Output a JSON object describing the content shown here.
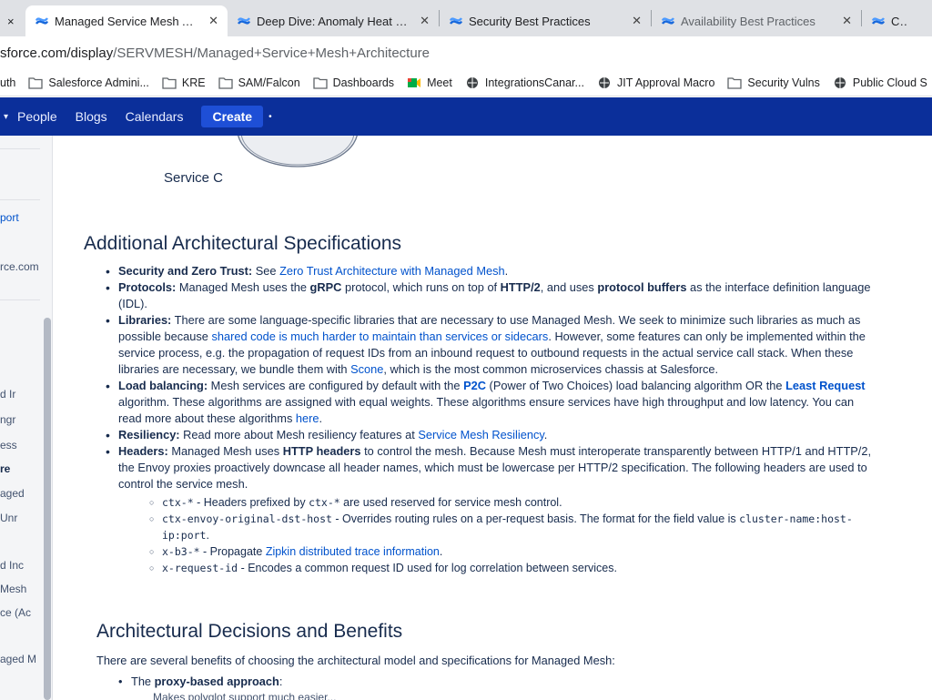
{
  "tabs": [
    {
      "title": "Managed Service Mesh Archite",
      "active": true
    },
    {
      "title": "Deep Dive: Anomaly Heat M..."
    },
    {
      "title": "Security Best Practices"
    },
    {
      "title": "Availability Best Practices"
    },
    {
      "title": "Chan"
    }
  ],
  "left_tab_close": "×",
  "url": {
    "host": "sforce.com/display",
    "path": "/SERVMESH/Managed+Service+Mesh+Architecture"
  },
  "bookmarks": [
    {
      "label": "uth",
      "icon": "none"
    },
    {
      "label": "Salesforce Admini...",
      "icon": "folder-icon"
    },
    {
      "label": "KRE",
      "icon": "folder-icon"
    },
    {
      "label": "SAM/Falcon",
      "icon": "folder-icon"
    },
    {
      "label": "Dashboards",
      "icon": "folder-icon"
    },
    {
      "label": "Meet",
      "icon": "meet-icon"
    },
    {
      "label": "IntegrationsCanar...",
      "icon": "globe-icon"
    },
    {
      "label": "JIT Approval Macro",
      "icon": "globe-icon"
    },
    {
      "label": "Security Vulns",
      "icon": "folder-icon"
    },
    {
      "label": "Public Cloud S",
      "icon": "globe-icon"
    }
  ],
  "nav": {
    "people": "People",
    "blogs": "Blogs",
    "calendars": "Calendars",
    "create": "Create"
  },
  "sidebar": {
    "items": [
      "port",
      "rce.com",
      "d Ir",
      "ngr",
      "ess",
      "re",
      "aged",
      "Unr",
      "d Inc",
      "Mesh",
      "ce (Ac",
      "aged M"
    ]
  },
  "diagram": {
    "service_label": "Service C"
  },
  "sections": {
    "additional": "Additional Architectural Specifications",
    "decisions": "Architectural Decisions and Benefits",
    "decisions_intro": "There are several benefits of choosing the architectural model and specifications for Managed Mesh:",
    "proxy_bullet_pre": "The ",
    "proxy_bullet_bold": "proxy-based approach",
    "proxy_bullet_post": ":",
    "proxy_sub": "Makes polyglot support much easier..."
  },
  "specs": {
    "security": {
      "label": "Security and Zero Trust:",
      "pre": " See ",
      "link": "Zero Trust Architecture with Managed Mesh",
      "post": "."
    },
    "protocols": {
      "label": "Protocols:",
      "t1": " Managed Mesh uses the ",
      "b1": "gRPC",
      "t2": " protocol, which runs on top of ",
      "b2": "HTTP/2",
      "t3": ", and uses ",
      "b3": "protocol buffers",
      "t4": " as the interface definition language (IDL)."
    },
    "libraries": {
      "label": "Libraries:",
      "t1": " There are some language-specific libraries that are necessary to use Managed Mesh. We seek to minimize such libraries as much as possible because ",
      "link1": "shared code is much harder to maintain than services or sidecars",
      "t2": ". However, some features can only be implemented within the service process, e.g. the propagation of request IDs from an inbound request to outbound requests in the actual service call stack. When these libraries are necessary, we bundle them with ",
      "link2": "Scone",
      "t3": ", which is the most common microservices chassis at Salesforce."
    },
    "loadbalancing": {
      "label": "Load balancing:",
      "t1": " Mesh services are configured by default with the ",
      "b1": "P2C",
      "t2": " (Power of Two Choices) load balancing algorithm OR the ",
      "b2": "Least Request",
      "t3": " algorithm. These algorithms are assigned with equal weights. These algorithms ensure services have high throughput and low latency. You can read more about these algorithms ",
      "link": "here",
      "t4": "."
    },
    "resiliency": {
      "label": "Resiliency:",
      "t1": " Read more about Mesh resiliency features at ",
      "link": "Service Mesh Resiliency",
      "t2": "."
    },
    "headers": {
      "label": "Headers:",
      "t1": " Managed Mesh uses ",
      "b1": "HTTP headers",
      "t2": " to control the mesh. Because Mesh must interoperate transparently between HTTP/1 and HTTP/2, the Envoy proxies proactively downcase all header names, which must be lowercase per HTTP/2 specification. The following headers are used to control the service mesh."
    }
  },
  "headers_list": [
    {
      "code": "ctx-*",
      "text": " - Headers prefixed by ",
      "code2": "ctx-*",
      "text2": " are used reserved for service mesh control."
    },
    {
      "code": "ctx-envoy-original-dst-host",
      "text": " - Overrides routing rules on a per-request basis. The format for the field value is ",
      "code2": "cluster-name:host-ip:port",
      "text2": "."
    },
    {
      "code": "x-b3-*",
      "text": " - Propagate ",
      "link": "Zipkin distributed trace information",
      "text2": "."
    },
    {
      "code": "x-request-id",
      "text": " - Encodes a common request ID used for log correlation between services."
    }
  ],
  "colors": {
    "nav_bg": "#0b2f9a",
    "link": "#0052cc",
    "text": "#172b4d"
  }
}
